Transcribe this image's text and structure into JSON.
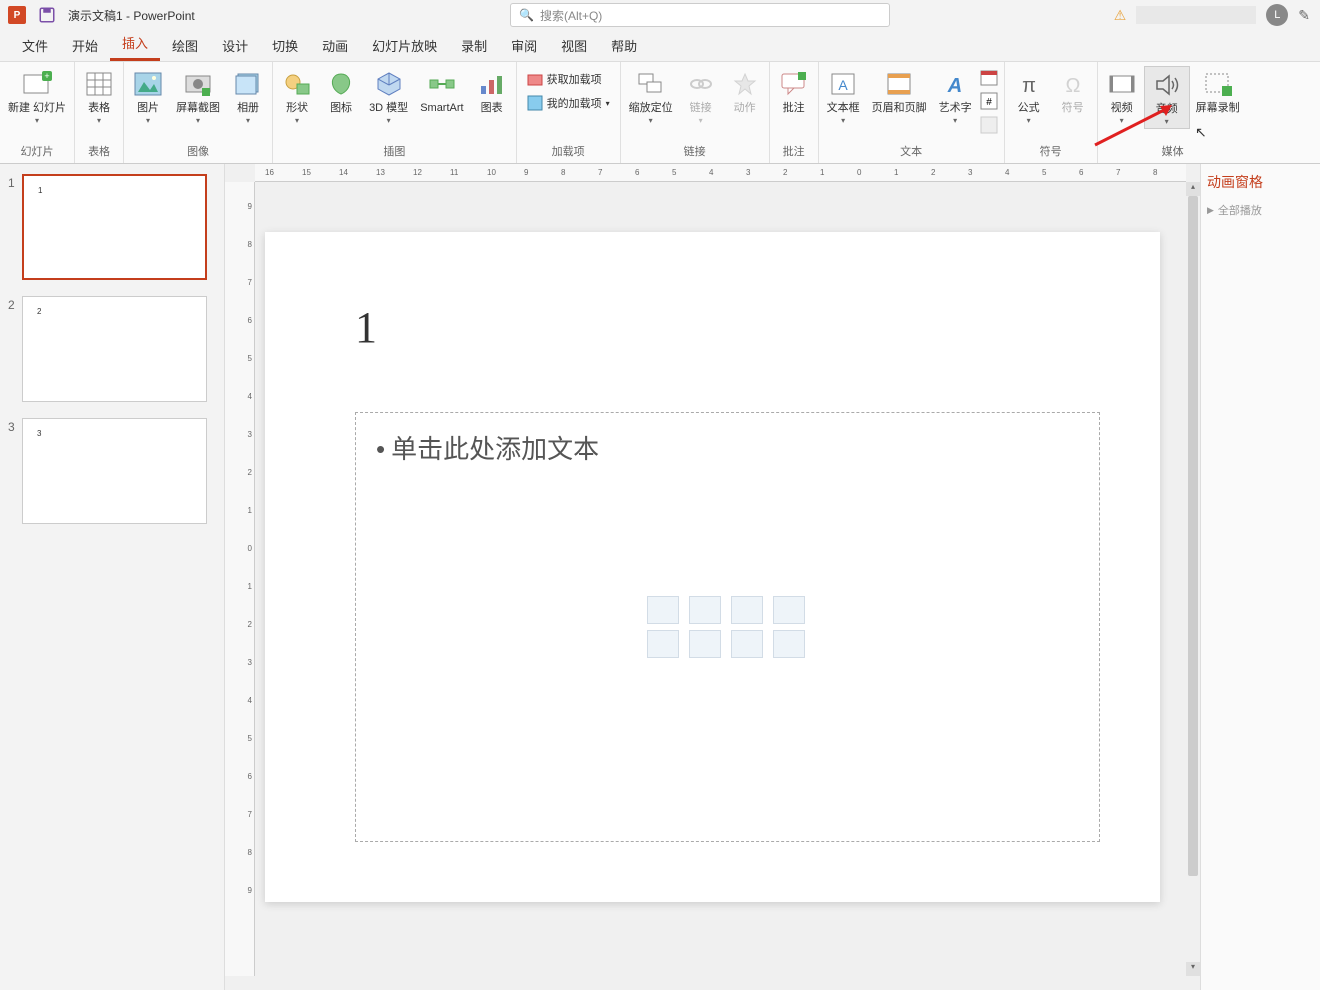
{
  "titlebar": {
    "doc_title": "演示文稿1  -  PowerPoint",
    "search_placeholder": "搜索(Alt+Q)",
    "user_initial": "L"
  },
  "tabs": [
    {
      "label": "文件"
    },
    {
      "label": "开始"
    },
    {
      "label": "插入",
      "active": true
    },
    {
      "label": "绘图"
    },
    {
      "label": "设计"
    },
    {
      "label": "切换"
    },
    {
      "label": "动画"
    },
    {
      "label": "幻灯片放映"
    },
    {
      "label": "录制"
    },
    {
      "label": "审阅"
    },
    {
      "label": "视图"
    },
    {
      "label": "帮助"
    }
  ],
  "ribbon": {
    "groups": [
      {
        "name": "幻灯片",
        "items": [
          {
            "label": "新建\n幻灯片",
            "icon": "new-slide",
            "dropdown": true
          }
        ]
      },
      {
        "name": "表格",
        "items": [
          {
            "label": "表格",
            "icon": "table",
            "dropdown": true
          }
        ]
      },
      {
        "name": "图像",
        "items": [
          {
            "label": "图片",
            "icon": "picture",
            "dropdown": true
          },
          {
            "label": "屏幕截图",
            "icon": "screenshot",
            "dropdown": true
          },
          {
            "label": "相册",
            "icon": "album",
            "dropdown": true
          }
        ]
      },
      {
        "name": "插图",
        "items": [
          {
            "label": "形状",
            "icon": "shapes",
            "dropdown": true
          },
          {
            "label": "图标",
            "icon": "icons"
          },
          {
            "label": "3D 模型",
            "icon": "3d",
            "dropdown": true
          },
          {
            "label": "SmartArt",
            "icon": "smartart"
          },
          {
            "label": "图表",
            "icon": "chart"
          }
        ]
      },
      {
        "name": "加载项",
        "sub": [
          {
            "label": "获取加载项",
            "icon": "store"
          },
          {
            "label": "我的加载项",
            "icon": "addins",
            "dropdown": true
          }
        ]
      },
      {
        "name": "链接",
        "items": [
          {
            "label": "缩放定位",
            "icon": "zoom",
            "dropdown": true
          },
          {
            "label": "链接",
            "icon": "link",
            "disabled": true,
            "dropdown": true
          },
          {
            "label": "动作",
            "icon": "action",
            "disabled": true
          }
        ]
      },
      {
        "name": "批注",
        "items": [
          {
            "label": "批注",
            "icon": "comment"
          }
        ]
      },
      {
        "name": "文本",
        "items": [
          {
            "label": "文本框",
            "icon": "textbox",
            "dropdown": true
          },
          {
            "label": "页眉和页脚",
            "icon": "header"
          },
          {
            "label": "艺术字",
            "icon": "wordart",
            "dropdown": true
          }
        ],
        "extra": true
      },
      {
        "name": "符号",
        "items": [
          {
            "label": "公式",
            "icon": "equation",
            "dropdown": true
          },
          {
            "label": "符号",
            "icon": "symbol",
            "disabled": true
          }
        ]
      },
      {
        "name": "媒体",
        "items": [
          {
            "label": "视频",
            "icon": "video",
            "dropdown": true
          },
          {
            "label": "音频",
            "icon": "audio",
            "dropdown": true,
            "hover": true
          },
          {
            "label": "屏幕录制",
            "icon": "record"
          }
        ]
      }
    ]
  },
  "thumbnails": [
    {
      "num": "1",
      "content": "1",
      "active": true
    },
    {
      "num": "2",
      "content": "2"
    },
    {
      "num": "3",
      "content": "3"
    }
  ],
  "slide": {
    "title_text": "1",
    "body_placeholder": "单击此处添加文本"
  },
  "ruler_h": [
    "16",
    "15",
    "14",
    "13",
    "12",
    "11",
    "10",
    "9",
    "8",
    "7",
    "6",
    "5",
    "4",
    "3",
    "2",
    "1",
    "0",
    "1",
    "2",
    "3",
    "4",
    "5",
    "6",
    "7",
    "8"
  ],
  "ruler_v": [
    "9",
    "8",
    "7",
    "6",
    "5",
    "4",
    "3",
    "2",
    "1",
    "0",
    "1",
    "2",
    "3",
    "4",
    "5",
    "6",
    "7",
    "8",
    "9"
  ],
  "side_pane": {
    "title": "动画窗格",
    "play_all": "全部播放"
  }
}
